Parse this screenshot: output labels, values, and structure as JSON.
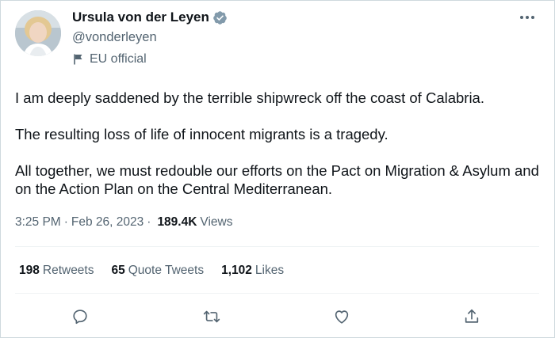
{
  "author": {
    "name": "Ursula von der Leyen",
    "handle": "@vonderleyen",
    "label": "EU official",
    "verified_color": "#829aab"
  },
  "tweet": {
    "paragraphs": [
      "I am deeply saddened by the terrible shipwreck off the coast of Calabria.",
      "The resulting loss of life of innocent migrants is a tragedy.",
      "All together, we must redouble our efforts on the Pact on Migration & Asylum and on the Action Plan on the Central Mediterranean."
    ]
  },
  "meta": {
    "time": "3:25 PM",
    "separator": "·",
    "date": "Feb 26, 2023",
    "views_count": "189.4K",
    "views_label": "Views"
  },
  "stats": {
    "retweets_count": "198",
    "retweets_label": "Retweets",
    "quotes_count": "65",
    "quotes_label": "Quote Tweets",
    "likes_count": "1,102",
    "likes_label": "Likes"
  },
  "icons": {
    "verified": "verified-badge-icon",
    "label": "flag-icon",
    "more": "more-icon",
    "reply": "reply-icon",
    "retweet": "retweet-icon",
    "like": "heart-icon",
    "share": "share-icon"
  },
  "colors": {
    "text": "#0f1419",
    "secondary": "#536471",
    "border": "#cfd9de"
  }
}
